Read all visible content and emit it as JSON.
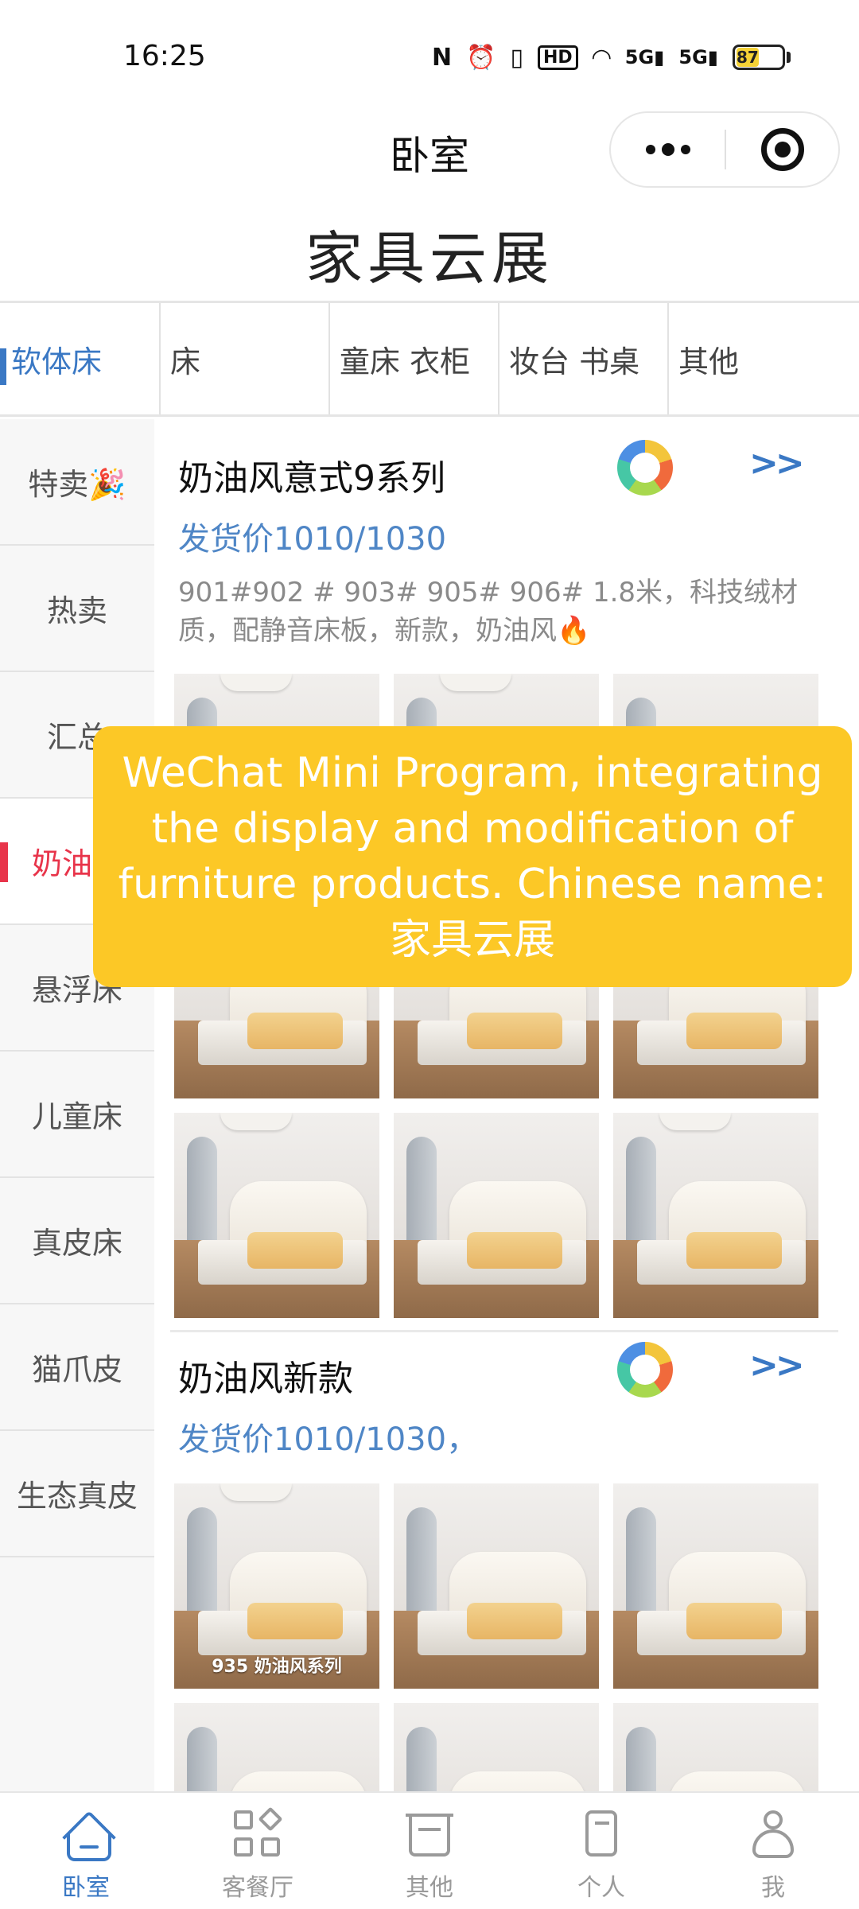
{
  "status_bar": {
    "time": "16:25",
    "icons": [
      "nfc-icon",
      "alarm-icon",
      "vibrate-icon",
      "hd-icon",
      "wifi-icon",
      "signal-5g-icon",
      "signal-5g-icon"
    ],
    "battery": "87"
  },
  "title_bar": {
    "title": "卧室"
  },
  "app": {
    "title": "家具云展"
  },
  "category_tabs": [
    {
      "label": "软体床",
      "active": true
    },
    {
      "label": "床"
    },
    {
      "label": "童床 衣柜"
    },
    {
      "label": "妆台 书桌"
    },
    {
      "label": "其他"
    }
  ],
  "sidebar": [
    {
      "label": "特卖🎉"
    },
    {
      "label": "热卖"
    },
    {
      "label": "汇总"
    },
    {
      "label": "奶油风",
      "active": true
    },
    {
      "label": "悬浮床"
    },
    {
      "label": "儿童床"
    },
    {
      "label": "真皮床"
    },
    {
      "label": "猫爪皮"
    },
    {
      "label": "生态真皮"
    }
  ],
  "sections": [
    {
      "title": "奶油风意式9系列",
      "more": ">>",
      "price": "发货价1010/1030",
      "description": "901#902 #  903# 905# 906# 1.8米，科技绒材质，配静音床板，新款，奶油风🔥"
    },
    {
      "title": "奶油风新款",
      "more": ">>",
      "price": "发货价1010/1030，",
      "first_image_label": "935 奶油风系列"
    }
  ],
  "overlay": {
    "text": "WeChat Mini Program, integrating the display and modification of furniture products. Chinese name: 家具云展"
  },
  "tab_bar": [
    {
      "label": "卧室",
      "icon": "home-icon",
      "active": true
    },
    {
      "label": "客餐厅",
      "icon": "grid-icon"
    },
    {
      "label": "其他",
      "icon": "basin-icon"
    },
    {
      "label": "个人",
      "icon": "phone-icon"
    },
    {
      "label": "我",
      "icon": "user-icon"
    }
  ],
  "colors": {
    "accent_blue": "#3a78c4",
    "accent_red": "#e8344a",
    "overlay_yellow": "#fcc826"
  }
}
